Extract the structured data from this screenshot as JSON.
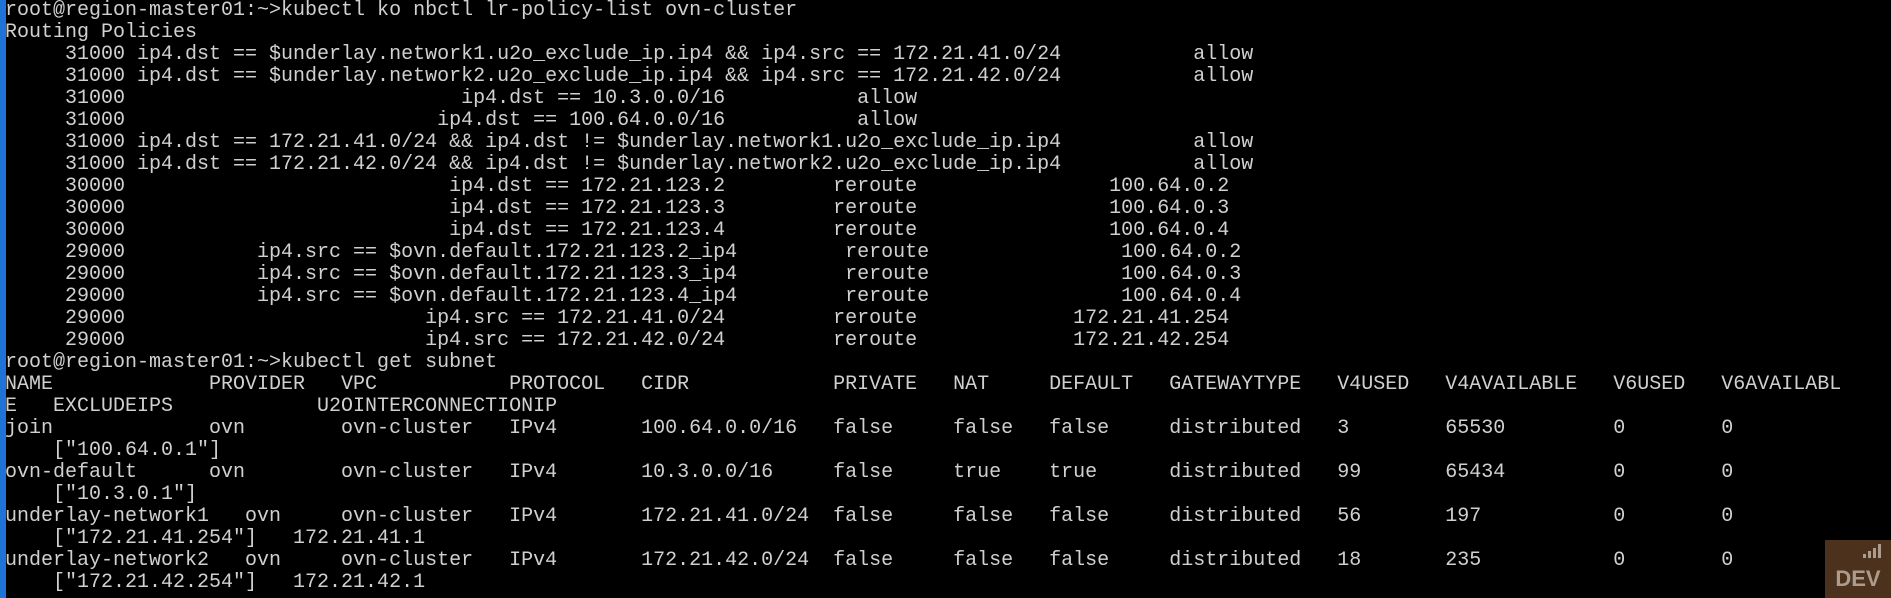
{
  "terminal": {
    "lines": [
      "root@region-master01:~>kubectl ko nbctl lr-policy-list ovn-cluster",
      "Routing Policies",
      "     31000 ip4.dst == $underlay.network1.u2o_exclude_ip.ip4 && ip4.src == 172.21.41.0/24           allow",
      "     31000 ip4.dst == $underlay.network2.u2o_exclude_ip.ip4 && ip4.src == 172.21.42.0/24           allow",
      "     31000                            ip4.dst == 10.3.0.0/16           allow",
      "     31000                          ip4.dst == 100.64.0.0/16           allow",
      "     31000 ip4.dst == 172.21.41.0/24 && ip4.dst != $underlay.network1.u2o_exclude_ip.ip4           allow",
      "     31000 ip4.dst == 172.21.42.0/24 && ip4.dst != $underlay.network2.u2o_exclude_ip.ip4           allow",
      "     30000                           ip4.dst == 172.21.123.2         reroute                100.64.0.2",
      "     30000                           ip4.dst == 172.21.123.3         reroute                100.64.0.3",
      "     30000                           ip4.dst == 172.21.123.4         reroute                100.64.0.4",
      "     29000           ip4.src == $ovn.default.172.21.123.2_ip4         reroute                100.64.0.2",
      "     29000           ip4.src == $ovn.default.172.21.123.3_ip4         reroute                100.64.0.3",
      "     29000           ip4.src == $ovn.default.172.21.123.4_ip4         reroute                100.64.0.4",
      "     29000                         ip4.src == 172.21.41.0/24         reroute             172.21.41.254",
      "     29000                         ip4.src == 172.21.42.0/24         reroute             172.21.42.254",
      "root@region-master01:~>kubectl get subnet",
      "NAME             PROVIDER   VPC           PROTOCOL   CIDR            PRIVATE   NAT     DEFAULT   GATEWAYTYPE   V4USED   V4AVAILABLE   V6USED   V6AVAILABL",
      "E   EXCLUDEIPS            U2OINTERCONNECTIONIP",
      "join             ovn        ovn-cluster   IPv4       100.64.0.0/16   false     false   false     distributed   3        65530         0        0",
      "    [\"100.64.0.1\"]",
      "ovn-default      ovn        ovn-cluster   IPv4       10.3.0.0/16     false     true    true      distributed   99       65434         0        0",
      "    [\"10.3.0.1\"]",
      "underlay-network1   ovn     ovn-cluster   IPv4       172.21.41.0/24  false     false   false     distributed   56       197           0        0",
      "    [\"172.21.41.254\"]   172.21.41.1",
      "underlay-network2   ovn     ovn-cluster   IPv4       172.21.42.0/24  false     false   false     distributed   18       235           0        0"
    ],
    "last_line": "    [\"172.21.42.254\"]   172.21.42.1"
  },
  "watermark": {
    "label": "DEV",
    "icon": "signal-bars-icon"
  },
  "colors": {
    "background": "#000000",
    "text": "#d0d0d0",
    "left_bar": "#1f72d6"
  }
}
